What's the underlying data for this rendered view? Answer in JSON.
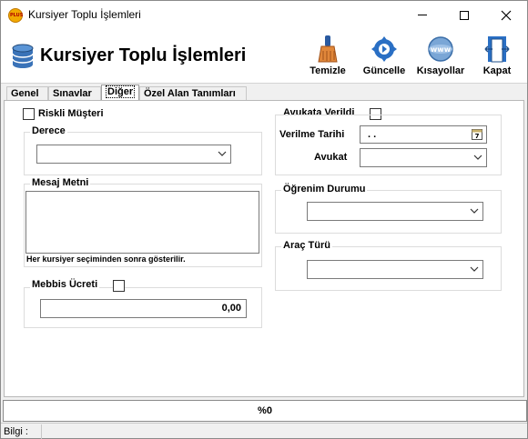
{
  "window": {
    "title": "Kursiyer Toplu İşlemleri",
    "icon_text": "PLUS"
  },
  "header": {
    "title": "Kursiyer Toplu İşlemleri"
  },
  "toolbar": {
    "temizle": "Temizle",
    "guncelle": "Güncelle",
    "kisayollar": "Kısayollar",
    "kapat": "Kapat"
  },
  "tabs": [
    "Genel",
    "Sınavlar",
    "Diğer",
    "Özel Alan Tanımları"
  ],
  "active_tab": "Diğer",
  "left": {
    "riskli_musteri": "Riskli Müşteri",
    "derece": {
      "title": "Derece",
      "value": ""
    },
    "mesaj": {
      "title": "Mesaj Metni",
      "value": "",
      "hint": "Her kursiyer seçiminden sonra gösterilir."
    },
    "mebbis": {
      "title": "Mebbis Ücreti",
      "value": "0,00"
    }
  },
  "right": {
    "avukata_verildi": "Avukata Verildi",
    "verilme_tarihi": {
      "label": "Verilme Tarihi",
      "value": ". ."
    },
    "avukat": {
      "label": "Avukat",
      "value": ""
    },
    "ogrenim": {
      "title": "Öğrenim Durumu",
      "value": ""
    },
    "arac": {
      "title": "Araç Türü",
      "value": ""
    }
  },
  "progress": {
    "value": 0,
    "text": "%0"
  },
  "status": {
    "label": "Bilgi :"
  }
}
